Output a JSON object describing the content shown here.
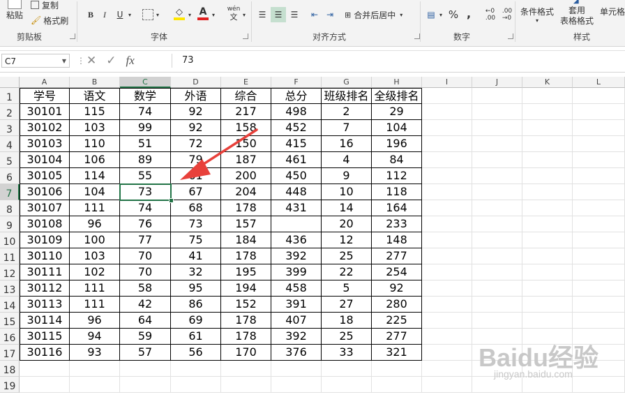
{
  "ribbon": {
    "clipboard": {
      "paste": "粘贴",
      "copy": "复制",
      "format_painter": "格式刷",
      "group": "剪贴板"
    },
    "font": {
      "group": "字体",
      "bold": "B",
      "italic": "I",
      "underline": "U",
      "wen": "wén",
      "wen_char": "文"
    },
    "alignment": {
      "merge": "合并后居中",
      "group": "对齐方式"
    },
    "number": {
      "percent": "%",
      "comma": ",",
      "inc": "←0\n.00",
      "dec": ".00\n→0",
      "group": "数字"
    },
    "styles": {
      "conditional": "条件格式",
      "table_format_1": "套用",
      "table_format_2": "表格格式",
      "cell_styles": "单元格",
      "group": "样式"
    }
  },
  "formula_bar": {
    "name_box": "C7",
    "fx": "fx",
    "value": "73"
  },
  "columns": [
    "A",
    "B",
    "C",
    "D",
    "E",
    "F",
    "G",
    "H",
    "I",
    "J",
    "K",
    "L"
  ],
  "rows": [
    "1",
    "2",
    "3",
    "4",
    "5",
    "6",
    "7",
    "8",
    "9",
    "10",
    "11",
    "12",
    "13",
    "14",
    "15",
    "16",
    "17",
    "18",
    "19"
  ],
  "headers": [
    "学号",
    "语文",
    "数学",
    "外语",
    "综合",
    "总分",
    "班级排名",
    "全级排名"
  ],
  "table": [
    [
      "30101",
      "115",
      "74",
      "92",
      "217",
      "498",
      "2",
      "29"
    ],
    [
      "30102",
      "103",
      "99",
      "92",
      "158",
      "452",
      "7",
      "104"
    ],
    [
      "30103",
      "110",
      "51",
      "72",
      "150",
      "415",
      "16",
      "196"
    ],
    [
      "30104",
      "106",
      "89",
      "79",
      "187",
      "461",
      "4",
      "84"
    ],
    [
      "30105",
      "114",
      "55",
      "61",
      "200",
      "450",
      "9",
      "112"
    ],
    [
      "30106",
      "104",
      "73",
      "67",
      "204",
      "448",
      "10",
      "118"
    ],
    [
      "30107",
      "111",
      "74",
      "68",
      "178",
      "431",
      "14",
      "164"
    ],
    [
      "30108",
      "96",
      "76",
      "73",
      "157",
      "",
      "20",
      "233"
    ],
    [
      "30109",
      "100",
      "77",
      "75",
      "184",
      "436",
      "12",
      "148"
    ],
    [
      "30110",
      "103",
      "70",
      "41",
      "178",
      "392",
      "25",
      "277"
    ],
    [
      "30111",
      "102",
      "70",
      "32",
      "195",
      "399",
      "22",
      "254"
    ],
    [
      "30112",
      "111",
      "58",
      "95",
      "194",
      "458",
      "5",
      "92"
    ],
    [
      "30113",
      "111",
      "42",
      "86",
      "152",
      "391",
      "27",
      "280"
    ],
    [
      "30114",
      "96",
      "64",
      "69",
      "178",
      "407",
      "18",
      "225"
    ],
    [
      "30115",
      "94",
      "59",
      "61",
      "178",
      "392",
      "25",
      "277"
    ],
    [
      "30116",
      "93",
      "57",
      "56",
      "170",
      "376",
      "33",
      "321"
    ]
  ],
  "selected_cell": "C7",
  "colors": {
    "accent": "#217346",
    "arrow": "#e8413b"
  },
  "watermark": {
    "brand": "Baidu经验",
    "url": "jingyan.baidu.com"
  }
}
